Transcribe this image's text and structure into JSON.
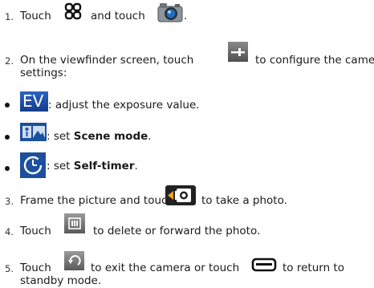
{
  "steps": {
    "s1": {
      "num": "1.",
      "pre": "Touch",
      "mid": "and touch",
      "post": ".",
      "icon_a": "app-grid-icon",
      "icon_b": "camera-app-icon"
    },
    "s2": {
      "num": "2.",
      "pre": "On the viewfinder screen, touch",
      "post": "to configure the camera",
      "post2": "settings:",
      "icon": "settings-slider-icon"
    },
    "s3": {
      "num": "3.",
      "pre": "Frame the picture and touch",
      "post": "to take a photo.",
      "icon": "shutter-icon"
    },
    "s4": {
      "num": "4.",
      "pre": "Touch",
      "post": "to delete or forward the photo.",
      "icon": "thumbnail-icon"
    },
    "s5": {
      "num": "5.",
      "pre": "Touch",
      "mid": "to exit the camera or touch",
      "post": "to return to",
      "post2": "standby mode.",
      "icon_a": "exit-arrow-icon",
      "icon_b": "home-key-icon"
    }
  },
  "bullets": [
    {
      "icon": "ev-icon",
      "icon_text": "EV",
      "text": ": adjust the exposure value."
    },
    {
      "icon": "scene-mode-icon",
      "text": ": set ",
      "bold": "Scene mode",
      "end": "."
    },
    {
      "icon": "self-timer-icon",
      "text": ": set ",
      "bold": "Self-timer",
      "end": "."
    }
  ],
  "colors": {
    "icon_grey": "#6e6e6e",
    "icon_blue": "#1b4fa8",
    "text": "#1a1a1a"
  }
}
